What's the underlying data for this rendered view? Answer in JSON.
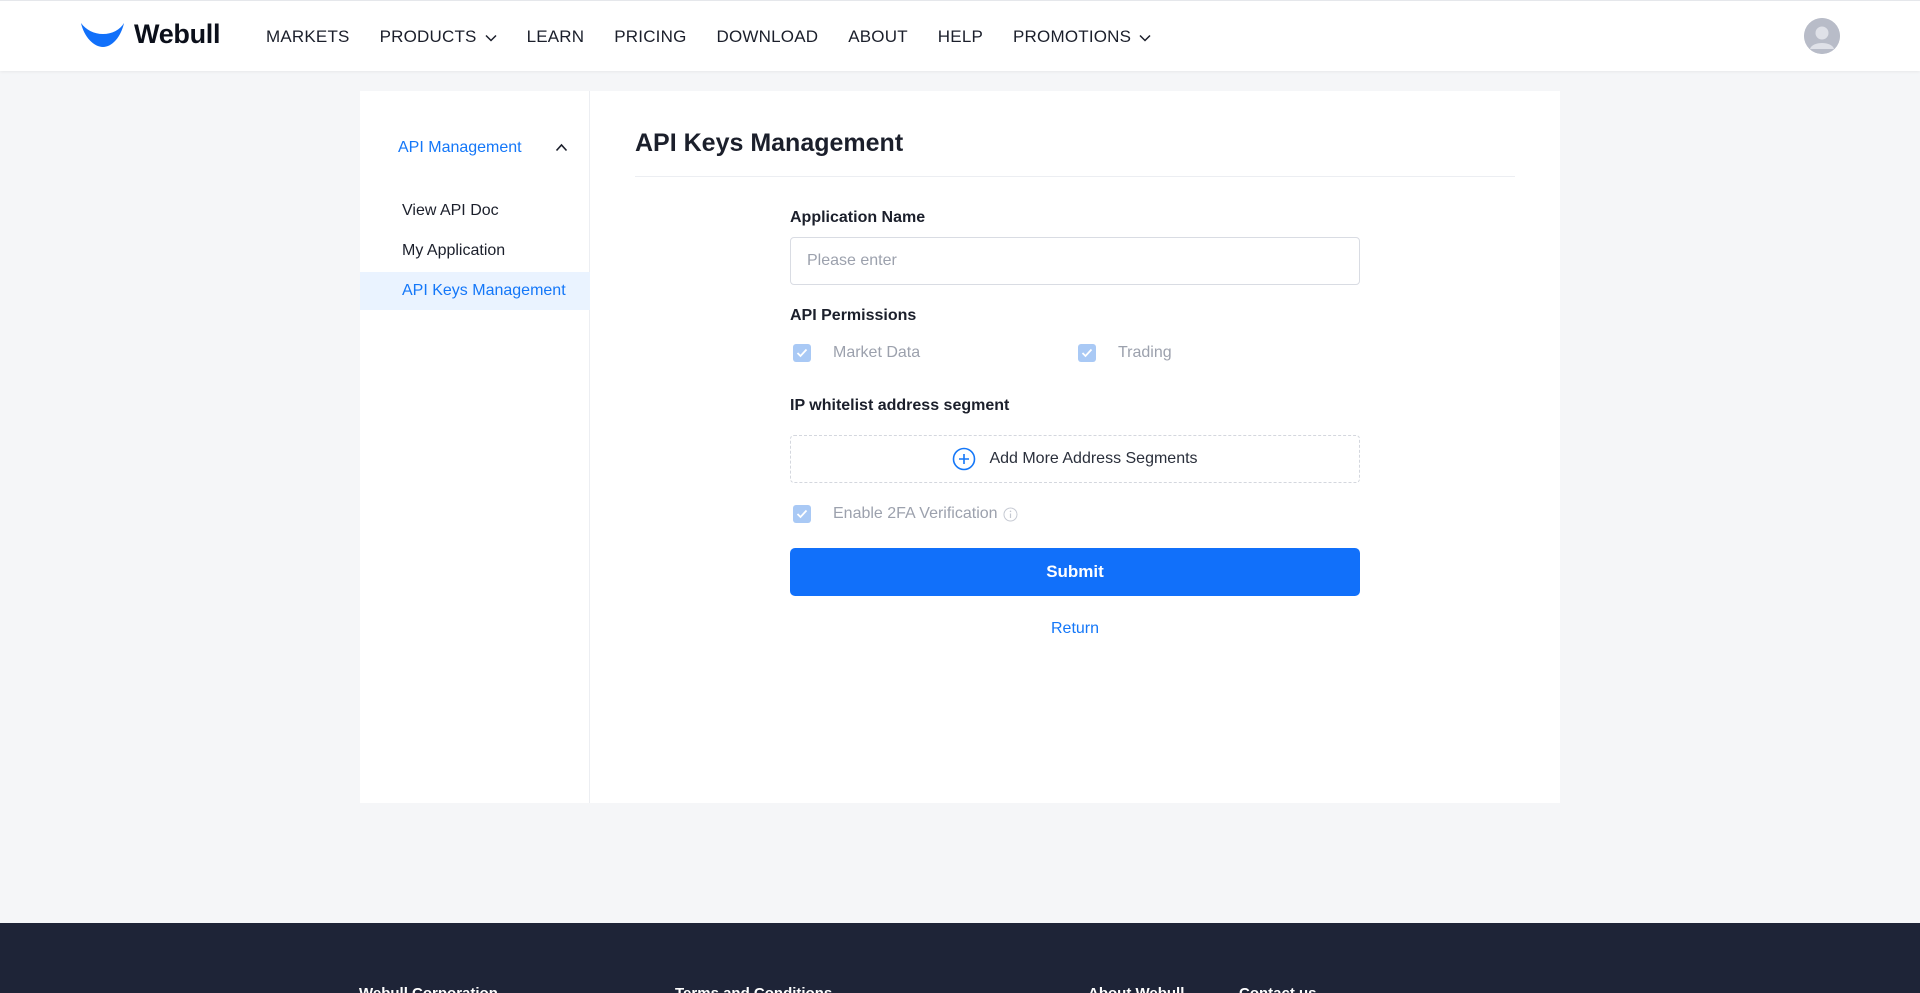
{
  "brand": {
    "name": "Webull",
    "logo_color": "#1170fa"
  },
  "nav": {
    "items": [
      {
        "label": "MARKETS",
        "has_dropdown": false
      },
      {
        "label": "PRODUCTS",
        "has_dropdown": true
      },
      {
        "label": "LEARN",
        "has_dropdown": false
      },
      {
        "label": "PRICING",
        "has_dropdown": false
      },
      {
        "label": "DOWNLOAD",
        "has_dropdown": false
      },
      {
        "label": "ABOUT",
        "has_dropdown": false
      },
      {
        "label": "HELP",
        "has_dropdown": false
      },
      {
        "label": "PROMOTIONS",
        "has_dropdown": true
      }
    ],
    "avatar_icon": "user-avatar-icon"
  },
  "sidebar": {
    "group_label": "API Management",
    "group_expanded": true,
    "items": [
      {
        "label": "View API Doc",
        "active": false
      },
      {
        "label": "My Application",
        "active": false
      },
      {
        "label": "API Keys Management",
        "active": true
      }
    ]
  },
  "main": {
    "title": "API Keys Management",
    "form": {
      "app_name_label": "Application Name",
      "app_name_placeholder": "Please enter",
      "app_name_value": "",
      "permissions_label": "API Permissions",
      "permissions": [
        {
          "label": "Market Data",
          "checked": true,
          "disabled": true
        },
        {
          "label": "Trading",
          "checked": true,
          "disabled": true
        }
      ],
      "ip_label": "IP whitelist address segment",
      "add_segment_label": "Add More Address Segments",
      "twofa_label": "Enable 2FA Verification",
      "twofa_checked": true,
      "submit_label": "Submit",
      "return_label": "Return"
    }
  },
  "footer": {
    "links": [
      "Webull Corporation",
      "Terms and Conditions",
      "About Webull",
      "Contact us"
    ]
  },
  "colors": {
    "accent": "#1170fa",
    "link": "#1477f8",
    "active_bg": "#eaf3ff",
    "page_bg": "#f5f6f8",
    "footer_bg": "#1e2437",
    "checkbox_disabled": "#a9c9f5"
  }
}
